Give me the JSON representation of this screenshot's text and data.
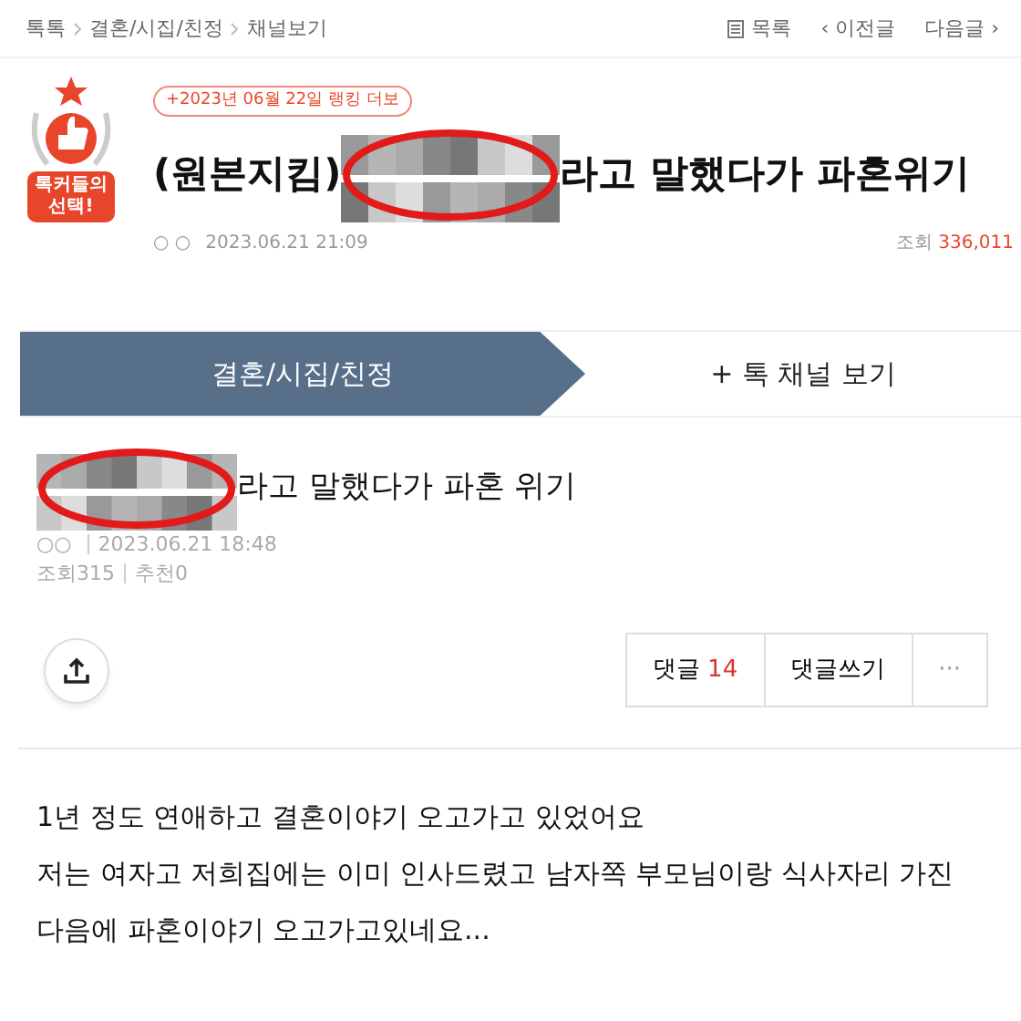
{
  "breadcrumb": [
    "톡톡",
    "결혼/시집/친정",
    "채널보기"
  ],
  "nav": {
    "list": "목록",
    "prev": "‹ 이전글",
    "next": "다음글 ›"
  },
  "header": {
    "badge_text": "톡커들의 선택!",
    "ranking": "+2023년 06월 22일 랭킹 더보",
    "title_start": "(원본지킴)",
    "title_end": "라고 말했다가 파혼위기",
    "author": "○ ○",
    "date": "2023.06.21 21:09",
    "views_label": "조회",
    "views": "336,011"
  },
  "tabs": [
    {
      "label": "결혼/시집/친정",
      "selected": true
    },
    {
      "label": "+ 톡 채널 보기",
      "selected": false
    }
  ],
  "post": {
    "title_end": "라고 말했다가 파혼 위기",
    "author": "○○",
    "date": "2023.06.21 18:48",
    "views": "조회315",
    "likes": "추천0"
  },
  "actions": {
    "comments_label": "댓글",
    "comments_count": "14",
    "write": "댓글쓰기",
    "more": "···"
  },
  "body": [
    "1년 정도 연애하고 결혼이야기 오고가고 있었어요",
    "저는 여자고 저희집에는 이미 인사드렸고 남자쪽 부모님이랑 식사자리 가진 다음에 파혼이야기 오고가고있네요..."
  ]
}
